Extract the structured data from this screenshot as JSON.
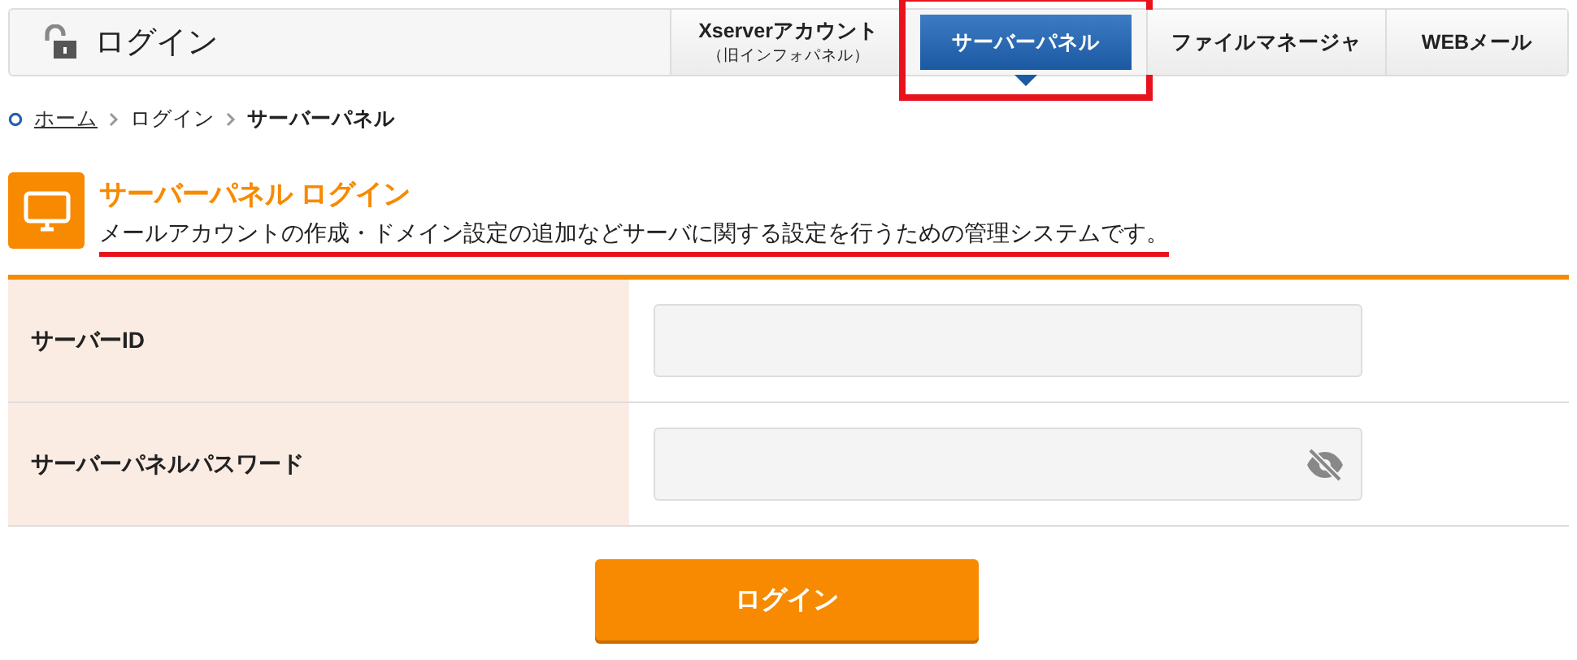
{
  "header": {
    "title": "ログイン"
  },
  "tabs": [
    {
      "label": "Xserverアカウント",
      "sublabel": "（旧インフォパネル）",
      "selected": false,
      "highlighted": false
    },
    {
      "label": "サーバーパネル",
      "selected": true,
      "highlighted": true
    },
    {
      "label": "ファイルマネージャ",
      "selected": false,
      "highlighted": false
    },
    {
      "label": "WEBメール",
      "selected": false,
      "highlighted": false
    }
  ],
  "breadcrumb": [
    {
      "label": "ホーム",
      "link": true
    },
    {
      "label": "ログイン",
      "link": false
    },
    {
      "label": "サーバーパネル",
      "link": false
    }
  ],
  "section": {
    "title": "サーバーパネル ログイン",
    "description": "メールアカウントの作成・ドメイン設定の追加などサーバに関する設定を行うための管理システムです。",
    "underlined": true
  },
  "form": [
    {
      "label": "サーバーID",
      "kind": "text"
    },
    {
      "label": "サーバーパネルパスワード",
      "kind": "password"
    }
  ],
  "submit": "ログイン"
}
